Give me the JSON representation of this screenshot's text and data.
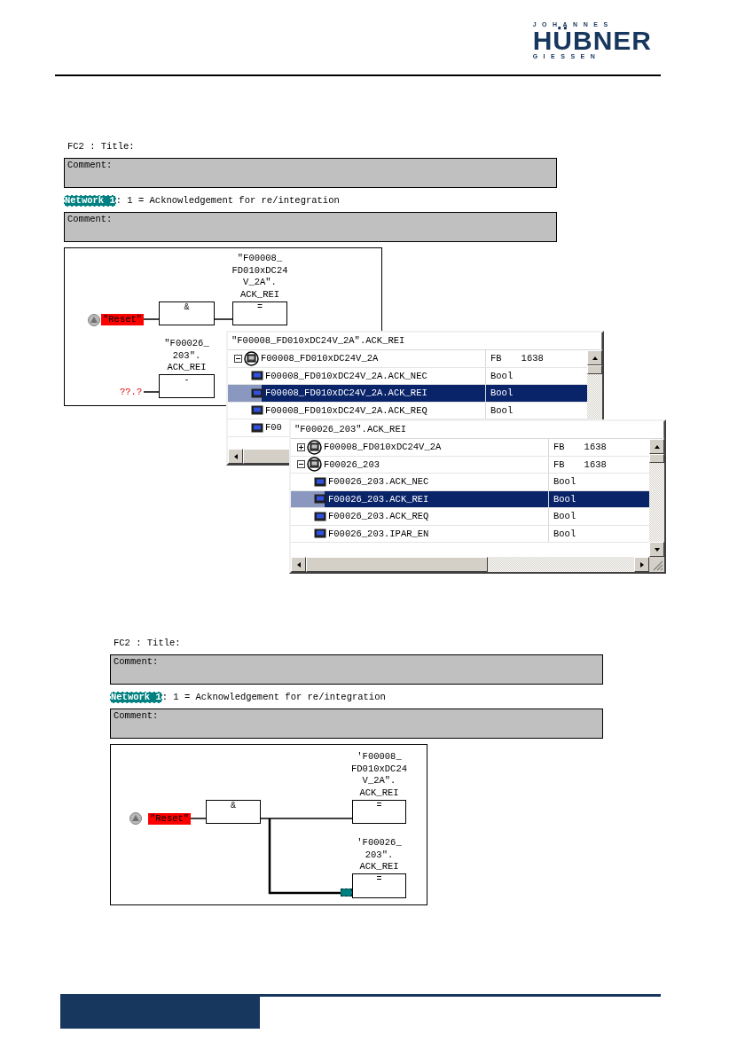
{
  "header": {
    "logo": {
      "top": "JOHANNES",
      "main": "HÜBNER",
      "bottom": "GIESSEN"
    }
  },
  "screens": [
    {
      "title": "FC2 : Title:",
      "comment_1": "Comment:",
      "network": {
        "badge": "Network 1",
        "title": ": 1 = Acknowledgement for re/integration"
      },
      "comment_2": "Comment:",
      "diagram": {
        "kind": "two_rungs",
        "contact": "\"Reset\"",
        "gate": "&",
        "coils": [
          {
            "address": "\"F00008_\nFD010xDC24\nV_2A\".\nACK_REI",
            "symbol": "="
          },
          {
            "address": "\"F00026_\n203\".\nACK_REI",
            "symbol": "-",
            "input": "??.?"
          }
        ]
      },
      "popups": [
        {
          "header": "\"F00008_FD010xDC24V_2A\".ACK_REI",
          "rows": [
            {
              "kind": "group",
              "expanded": true,
              "name": "F00008_FD010xDC24V_2A",
              "type": "FB",
              "number": "1638",
              "selected": false
            },
            {
              "kind": "item",
              "name": "F00008_FD010xDC24V_2A.ACK_NEC",
              "type": "Bool",
              "selected": false
            },
            {
              "kind": "item",
              "name": "F00008_FD010xDC24V_2A.ACK_REI",
              "type": "Bool",
              "selected": true
            },
            {
              "kind": "item",
              "name": "F00008_FD010xDC24V_2A.ACK_REQ",
              "type": "Bool",
              "selected": false
            },
            {
              "kind": "item",
              "name": "F00",
              "selected": false
            }
          ]
        },
        {
          "header": "\"F00026_203\".ACK_REI",
          "rows": [
            {
              "kind": "group",
              "expanded": false,
              "name": "F00008_FD010xDC24V_2A",
              "type": "FB",
              "number": "1638",
              "selected": false
            },
            {
              "kind": "group",
              "expanded": true,
              "name": "F00026_203",
              "type": "FB",
              "number": "1638",
              "selected": false
            },
            {
              "kind": "item",
              "name": "F00026_203.ACK_NEC",
              "type": "Bool",
              "selected": false
            },
            {
              "kind": "item",
              "name": "F00026_203.ACK_REI",
              "type": "Bool",
              "selected": true
            },
            {
              "kind": "item",
              "name": "F00026_203.ACK_REQ",
              "type": "Bool",
              "selected": false
            },
            {
              "kind": "item",
              "name": "F00026_203.IPAR_EN",
              "type": "Bool",
              "selected": false
            }
          ]
        }
      ]
    },
    {
      "title": "FC2 : Title:",
      "comment_1": "Comment:",
      "network": {
        "badge": "Network 1",
        "title": ": 1 = Acknowledgement for re/integration"
      },
      "comment_2": "Comment:",
      "diagram": {
        "kind": "branched",
        "contact": "\"Reset\"",
        "gate": "&",
        "coils": [
          {
            "address": "'F00008_\nFD010xDC24\nV_2A\".\nACK_REI",
            "symbol": "="
          },
          {
            "address": "'F00026_\n203\".\nACK_REI",
            "symbol": "="
          }
        ]
      }
    }
  ]
}
